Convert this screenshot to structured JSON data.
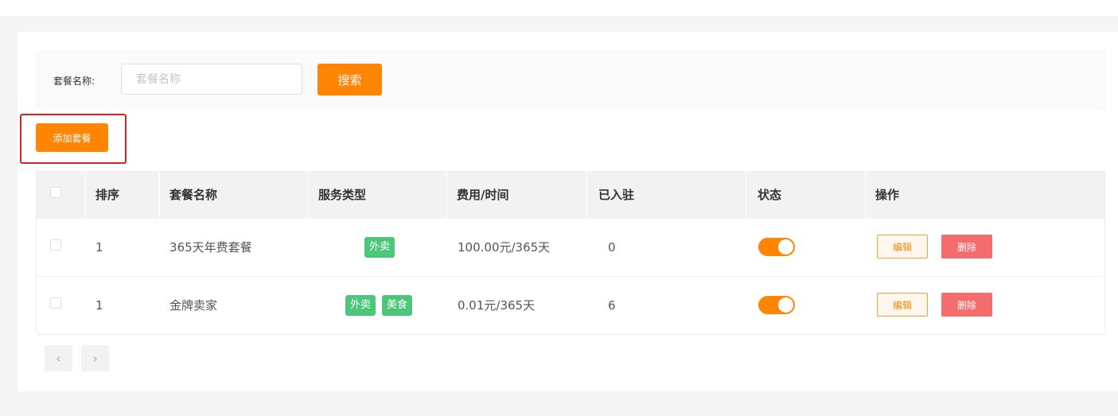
{
  "search": {
    "label": "套餐名称:",
    "placeholder": "套餐名称",
    "value": "",
    "button_label": "搜索"
  },
  "toolbar": {
    "add_label": "添加套餐"
  },
  "table": {
    "columns": [
      "排序",
      "套餐名称",
      "服务类型",
      "费用/时间",
      "已入驻",
      "状态",
      "操作"
    ],
    "rows": [
      {
        "order": "1",
        "name": "365天年费套餐",
        "tags": [
          "外卖"
        ],
        "fee": "100.00元/365天",
        "joined": "0",
        "status_on": true,
        "edit_label": "编辑",
        "delete_label": "删除"
      },
      {
        "order": "1",
        "name": "金牌卖家",
        "tags": [
          "外卖",
          "美食"
        ],
        "fee": "0.01元/365天",
        "joined": "6",
        "status_on": true,
        "edit_label": "编辑",
        "delete_label": "删除"
      }
    ]
  },
  "pagination": {
    "prev_glyph": "‹",
    "next_glyph": "›"
  },
  "colors": {
    "accent": "#ff8503",
    "tag": "#4cc77a",
    "danger": "#f56c6c",
    "highlight": "#e02020"
  }
}
